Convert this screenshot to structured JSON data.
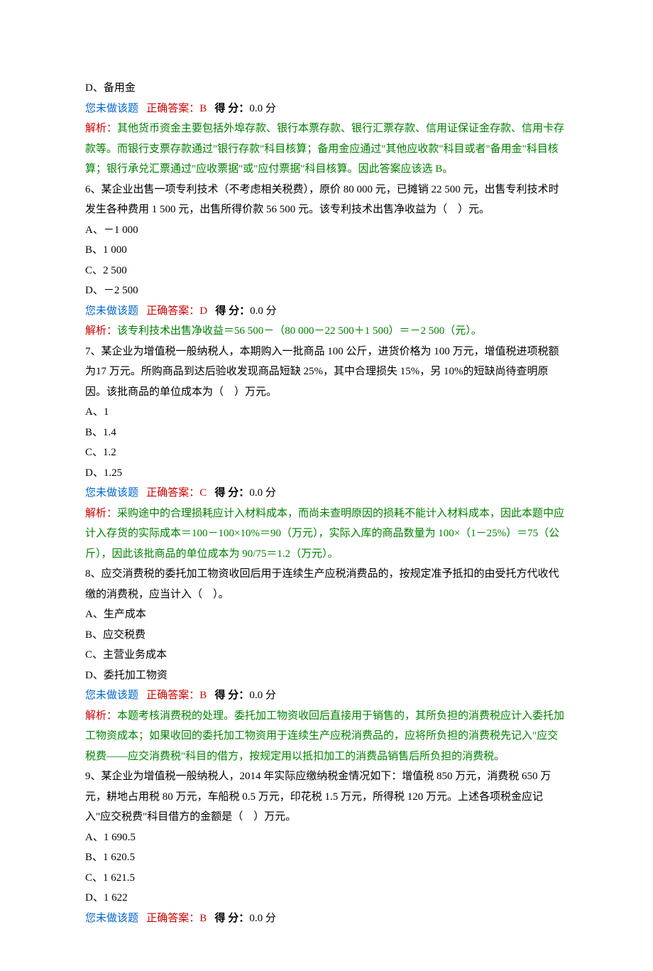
{
  "labels": {
    "not_answered": "您未做该题",
    "correct_prefix": "正确答案：",
    "score_label": "得 分：",
    "score_suffix": " 分",
    "explain_label": "解析："
  },
  "items": [
    {
      "prefix_option": "D、备用金",
      "correct": "B",
      "score": "0.0",
      "explanation": "其他货币资金主要包括外埠存款、银行本票存款、银行汇票存款、信用证保证金存款、信用卡存款等。而银行支票存款通过\"银行存款\"科目核算；备用金应通过\"其他应收款\"科目或者\"备用金\"科目核算；银行承兑汇票通过\"应收票据\"或\"应付票据\"科目核算。因此答案应该选 B。"
    },
    {
      "stem": "6、某企业出售一项专利技术（不考虑相关税费），原价 80 000 元，已摊销 22 500 元，出售专利技术时发生各种费用 1 500 元，出售所得价款 56 500 元。该专利技术出售净收益为（　）元。",
      "options": [
        "A、－1 000",
        "B、1 000",
        "C、2 500",
        "D、－2 500"
      ],
      "correct": "D",
      "score": "0.0",
      "explanation": "该专利技术出售净收益＝56 500－（80 000－22 500＋1 500）＝－2 500（元）。"
    },
    {
      "stem": "7、某企业为增值税一般纳税人，本期购入一批商品 100 公斤，进货价格为 100 万元，增值税进项税额为17 万元。所购商品到达后验收发现商品短缺 25%，其中合理损失 15%，另 10%的短缺尚待查明原因。该批商品的单位成本为（　）万元。",
      "options": [
        "A、1",
        "B、1.4",
        "C、1.2",
        "D、1.25"
      ],
      "correct": "C",
      "score": "0.0",
      "explanation": "采购途中的合理损耗应计入材料成本，而尚未查明原因的损耗不能计入材料成本，因此本题中应计入存货的实际成本＝100－100×10%＝90（万元），实际入库的商品数量为 100×（1－25%）＝75（公斤），因此该批商品的单位成本为 90/75＝1.2（万元）。"
    },
    {
      "stem": "8、应交消费税的委托加工物资收回后用于连续生产应税消费品的，按规定准予抵扣的由受托方代收代缴的消费税，应当计入（　）。",
      "options": [
        "A、生产成本",
        "B、应交税费",
        "C、主营业务成本",
        "D、委托加工物资"
      ],
      "correct": "B",
      "score": "0.0",
      "explanation": "本题考核消费税的处理。委托加工物资收回后直接用于销售的，其所负担的消费税应计入委托加工物资成本；如果收回的委托加工物资用于连续生产应税消费品的，应将所负担的消费税先记入\"应交税费——应交消费税\"科目的借方，按规定用以抵扣加工的消费品销售后所负担的消费税。"
    },
    {
      "stem": "9、某企业为增值税一般纳税人，2014 年实际应缴纳税金情况如下：增值税 850 万元，消费税 650 万元，耕地占用税 80 万元，车船税 0.5 万元，印花税 1.5 万元，所得税 120 万元。上述各项税金应记入\"应交税费\"科目借方的金额是（　）万元。",
      "options": [
        "A、1 690.5",
        "B、1 620.5",
        "C、1 621.5",
        "D、1 622"
      ],
      "correct": "B",
      "score": "0.0"
    }
  ]
}
